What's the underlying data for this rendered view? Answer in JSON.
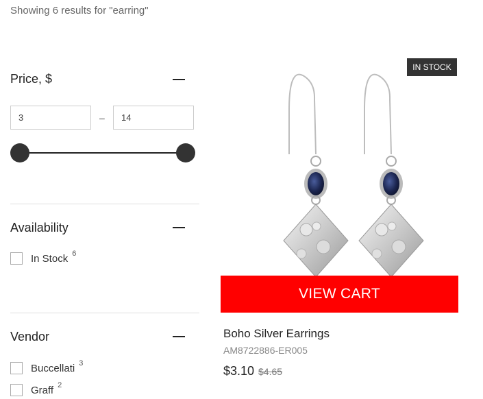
{
  "results_text": "Showing 6 results for \"earring\"",
  "filters": {
    "price": {
      "title": "Price, $",
      "min": "3",
      "max": "14",
      "separator": "–",
      "range_selected": [
        3,
        14
      ]
    },
    "availability": {
      "title": "Availability",
      "options": [
        {
          "label": "In Stock",
          "count": "6",
          "checked": false
        }
      ]
    },
    "vendor": {
      "title": "Vendor",
      "options": [
        {
          "label": "Buccellati",
          "count": "3",
          "checked": false
        },
        {
          "label": "Graff",
          "count": "2",
          "checked": false
        }
      ]
    }
  },
  "product": {
    "badge": "IN STOCK",
    "cta": "VIEW CART",
    "title": "Boho Silver Earrings",
    "sku": "AM8722886-ER005",
    "price": "$3.10",
    "old_price": "$4.65",
    "image_icon": "silver-drop-earrings",
    "colors": {
      "cta": "#ff0000",
      "badge": "#333333"
    }
  }
}
